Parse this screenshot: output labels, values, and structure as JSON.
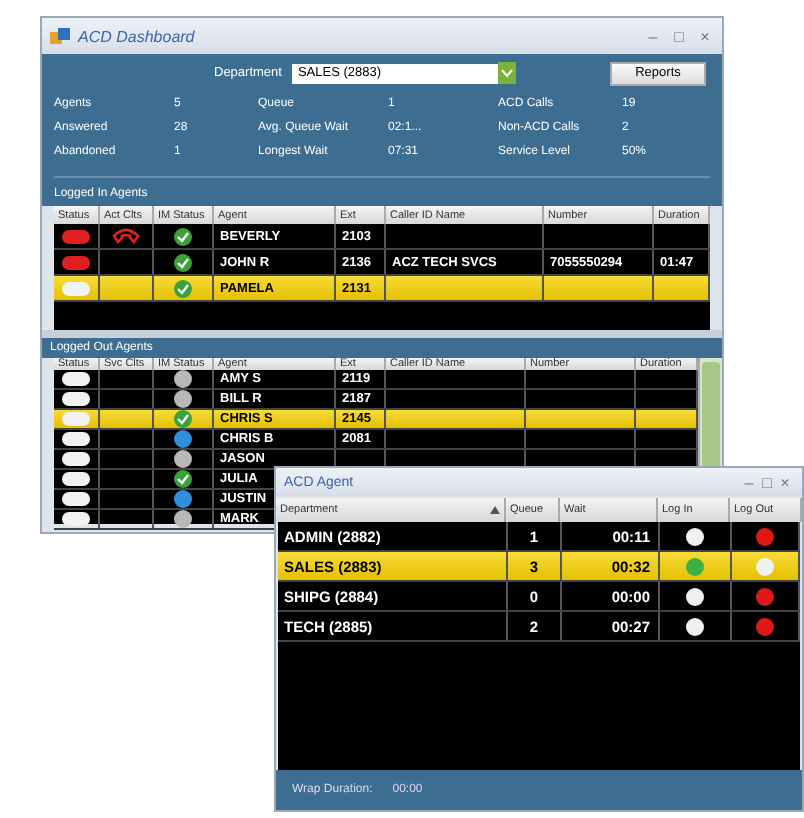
{
  "window": {
    "title": "ACD Dashboard",
    "controls": [
      "–",
      "□",
      "×"
    ]
  },
  "department": {
    "label": "Department",
    "value": "SALES (2883)"
  },
  "reports_button": "Reports",
  "stats": [
    {
      "label": "Agents",
      "value": "5"
    },
    {
      "label": "Queue",
      "value": "1"
    },
    {
      "label": "ACD Calls",
      "value": "19"
    },
    {
      "label": "Answered",
      "value": "28"
    },
    {
      "label": "Avg. Queue Wait",
      "value": "02:1..."
    },
    {
      "label": "Non-ACD Calls",
      "value": "2"
    },
    {
      "label": "Abandoned",
      "value": "1"
    },
    {
      "label": "Longest Wait",
      "value": "07:31"
    },
    {
      "label": "Service Level",
      "value": "50%"
    }
  ],
  "logged_in": {
    "title": "Logged In Agents",
    "columns": [
      "Status",
      "Act Clts",
      "IM Status",
      "Agent",
      "Ext",
      "Caller ID Name",
      "Number",
      "Duration"
    ],
    "rows": [
      {
        "status": {
          "color": "#e02020"
        },
        "active_call": true,
        "im_status": {
          "kind": "available"
        },
        "agent": "BEVERLY",
        "ext": "2103",
        "caller": "",
        "number": "",
        "duration": "",
        "selected": false
      },
      {
        "status": {
          "color": "#e02020"
        },
        "active_call": false,
        "im_status": {
          "kind": "available"
        },
        "agent": "JOHN R",
        "ext": "2136",
        "caller": "ACZ TECH SVCS",
        "number": "7055550294",
        "duration": "01:47",
        "selected": false
      },
      {
        "status": {
          "color": "#f2f2f2"
        },
        "active_call": false,
        "im_status": {
          "kind": "available"
        },
        "agent": "PAMELA",
        "ext": "2131",
        "caller": "",
        "number": "",
        "duration": "",
        "selected": true
      }
    ]
  },
  "logged_out": {
    "title": "Logged Out Agents",
    "columns": [
      "Status",
      "Svc Clts",
      "IM Status",
      "Agent",
      "Ext",
      "Caller ID Name",
      "Number",
      "Duration"
    ],
    "rows": [
      {
        "status": {
          "color": "#f2f2f2"
        },
        "im_status": {
          "kind": "offline"
        },
        "agent": "AMY S",
        "ext": "2119",
        "selected": false
      },
      {
        "status": {
          "color": "#f2f2f2"
        },
        "im_status": {
          "kind": "offline"
        },
        "agent": "BILL R",
        "ext": "2187",
        "selected": false
      },
      {
        "status": {
          "color": "#f2f2f2"
        },
        "im_status": {
          "kind": "available"
        },
        "agent": "CHRIS S",
        "ext": "2145",
        "selected": true
      },
      {
        "status": {
          "color": "#f2f2f2"
        },
        "im_status": {
          "kind": "away"
        },
        "agent": "CHRIS B",
        "ext": "2081",
        "selected": false
      },
      {
        "status": {
          "color": "#f2f2f2"
        },
        "im_status": {
          "kind": "offline"
        },
        "agent": "JASON",
        "ext": "",
        "selected": false
      },
      {
        "status": {
          "color": "#f2f2f2"
        },
        "im_status": {
          "kind": "available"
        },
        "agent": "JULIA",
        "ext": "",
        "selected": false
      },
      {
        "status": {
          "color": "#f2f2f2"
        },
        "im_status": {
          "kind": "away"
        },
        "agent": "JUSTIN",
        "ext": "",
        "selected": false
      },
      {
        "status": {
          "color": "#f2f2f2"
        },
        "im_status": {
          "kind": "offline"
        },
        "agent": "MARK",
        "ext": "",
        "selected": false
      }
    ]
  },
  "acd_agent": {
    "title": "ACD Agent",
    "controls": [
      "–",
      "□",
      "×"
    ],
    "columns": [
      "Department",
      "Queue",
      "Wait",
      "Log In",
      "Log Out"
    ],
    "rows": [
      {
        "department": "ADMIN (2882)",
        "queue": "1",
        "wait": "00:11",
        "log_in": {
          "color": "#f0f0f0"
        },
        "log_out": {
          "color": "#e01818"
        },
        "selected": false
      },
      {
        "department": "SALES (2883)",
        "queue": "3",
        "wait": "00:32",
        "log_in": {
          "color": "#3cb043"
        },
        "log_out": {
          "color": "#f0f0f0"
        },
        "selected": true
      },
      {
        "department": "SHIPG (2884)",
        "queue": "0",
        "wait": "00:00",
        "log_in": {
          "color": "#f0f0f0"
        },
        "log_out": {
          "color": "#e01818"
        },
        "selected": false
      },
      {
        "department": "TECH (2885)",
        "queue": "2",
        "wait": "00:27",
        "log_in": {
          "color": "#f0f0f0"
        },
        "log_out": {
          "color": "#e01818"
        },
        "selected": false
      }
    ],
    "wrap_label": "Wrap Duration:",
    "wrap_value": "00:00"
  }
}
